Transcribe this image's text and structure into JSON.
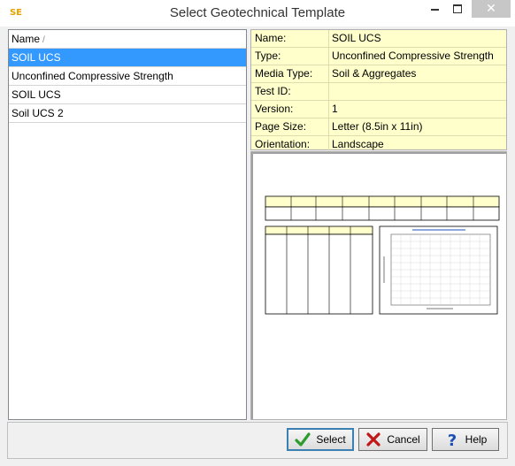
{
  "window": {
    "title": "Select Geotechnical Template",
    "app_icon_text": "SE",
    "close_glyph": "✕"
  },
  "list": {
    "column_header": "Name",
    "sort_indicator": "/",
    "items": [
      {
        "label": "SOIL UCS",
        "selected": true
      },
      {
        "label": "Unconfined Compressive Strength",
        "selected": false
      },
      {
        "label": "SOIL UCS",
        "selected": false
      },
      {
        "label": "Soil UCS 2",
        "selected": false
      }
    ]
  },
  "properties": [
    {
      "key": "Name:",
      "value": "SOIL UCS"
    },
    {
      "key": "Type:",
      "value": "Unconfined Compressive Strength"
    },
    {
      "key": "Media Type:",
      "value": "Soil & Aggregates"
    },
    {
      "key": "Test ID:",
      "value": ""
    },
    {
      "key": "Version:",
      "value": "1"
    },
    {
      "key": "Page Size:",
      "value": "Letter (8.5in x 11in)"
    },
    {
      "key": "Orientation:",
      "value": "Landscape"
    }
  ],
  "buttons": {
    "select": "Select",
    "cancel": "Cancel",
    "help": "Help"
  },
  "icons": {
    "select": "checkmark-icon",
    "cancel": "x-mark-icon",
    "help": "question-icon"
  },
  "colors": {
    "selection": "#3399ff",
    "properties_bg": "#ffffcc",
    "preview_header_fill": "#ffffcc",
    "check_green": "#2e9b2e",
    "cancel_red": "#c01818",
    "help_blue": "#1c4fb8"
  }
}
